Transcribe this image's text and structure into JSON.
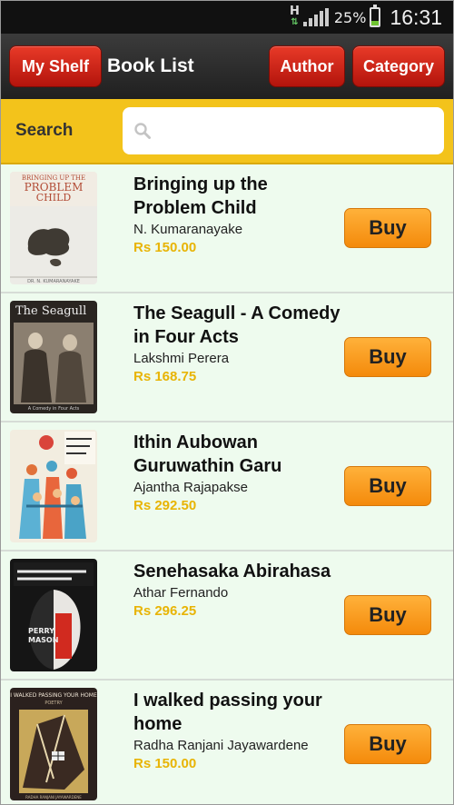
{
  "status_bar": {
    "network_type": "H",
    "battery_percent": "25%",
    "battery_level": 0.25,
    "time": "16:31"
  },
  "app_bar": {
    "my_shelf_label": "My Shelf",
    "title": "Book List",
    "author_label": "Author",
    "category_label": "Category"
  },
  "search": {
    "label": "Search",
    "value": "",
    "placeholder": ""
  },
  "books": [
    {
      "title": "Bringing up the Problem Child",
      "author": "N. Kumaranayake",
      "price": "Rs 150.00",
      "buy_label": "Buy",
      "cover_text": "BRINGING UP THE PROBLEM CHILD",
      "cover_author": "DR. N. KUMARANAYAKE"
    },
    {
      "title": "The Seagull - A Comedy in Four Acts",
      "author": "Lakshmi Perera",
      "price": "Rs 168.75",
      "buy_label": "Buy",
      "cover_text": "The Seagull",
      "cover_sub": "A Comedy in Four Acts"
    },
    {
      "title": "Ithin Aubowan Guruwathin Garu",
      "author": "Ajantha Rajapakse",
      "price": "Rs 292.50",
      "buy_label": "Buy"
    },
    {
      "title": "Senehasaka Abirahasa",
      "author": "Athar Fernando",
      "price": "Rs 296.25",
      "buy_label": "Buy",
      "cover_text": "PERRY MASON"
    },
    {
      "title": "I walked passing your home",
      "author": "Radha Ranjani Jayawardene",
      "price": "Rs 150.00",
      "buy_label": "Buy",
      "cover_text": "I WALKED PASSING YOUR HOME",
      "cover_sub": "POETRY"
    }
  ],
  "colors": {
    "accent_red": "#c9221a",
    "search_bar_yellow": "#f3c31b",
    "buy_orange": "#f7991f",
    "price_yellow": "#e8b405",
    "list_bg": "#eefbee"
  },
  "icons": {
    "search": "search-icon",
    "signal": "signal-icon",
    "battery": "battery-icon"
  }
}
